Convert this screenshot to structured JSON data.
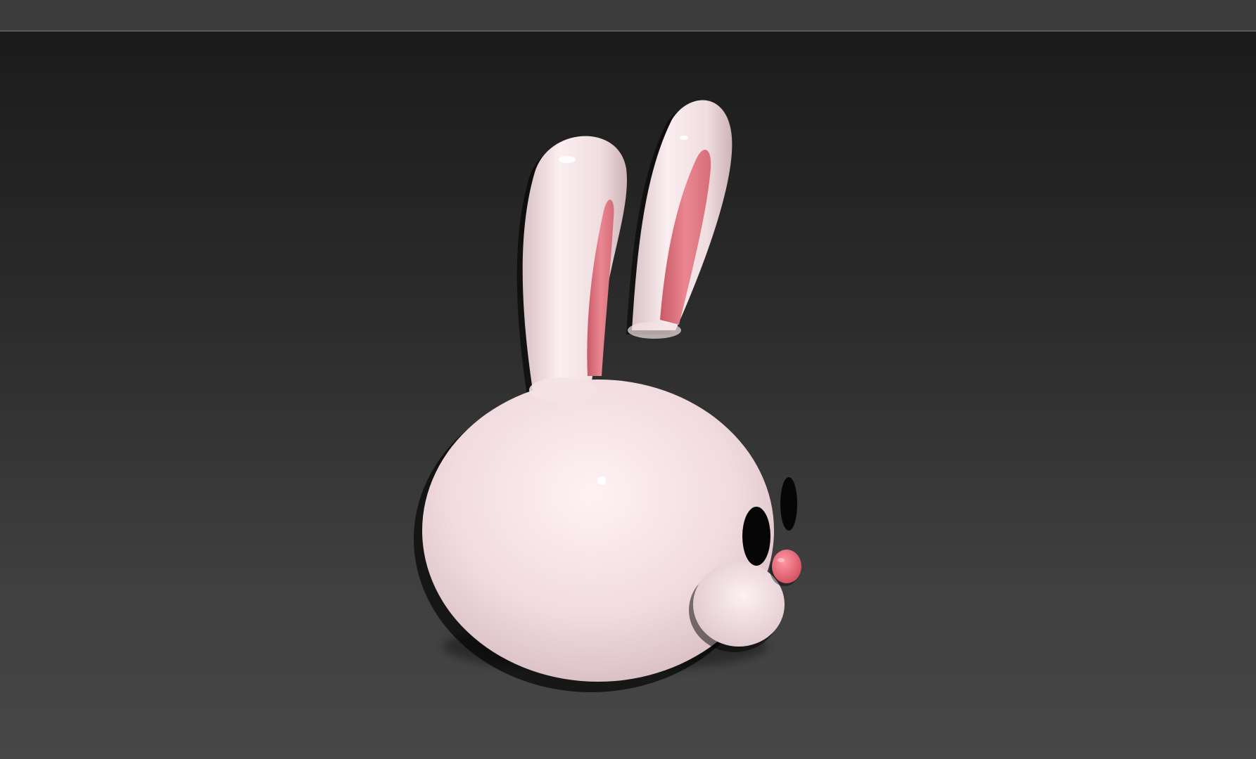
{
  "app": {
    "title": ""
  },
  "viewport": {
    "background_top": "#1b1b1b",
    "background_bottom": "#474747"
  },
  "model": {
    "name": "bunny-head",
    "colors": {
      "body": "#f3dfe2",
      "inner_ear": "#e57a84",
      "nose": "#ee6f7e",
      "eyes": "#060606"
    }
  }
}
